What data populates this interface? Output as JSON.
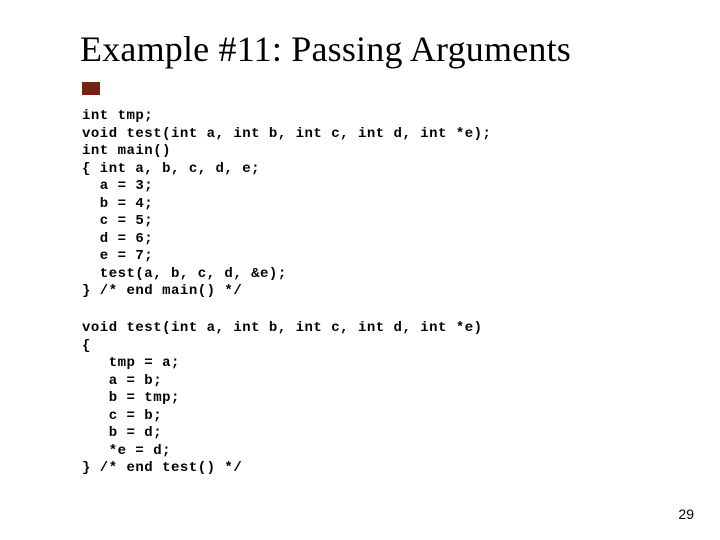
{
  "slide": {
    "title": "Example #11: Passing Arguments",
    "code_block_1": "int tmp;\nvoid test(int a, int b, int c, int d, int *e);\nint main()\n{ int a, b, c, d, e;\n  a = 3;\n  b = 4;\n  c = 5;\n  d = 6;\n  e = 7;\n  test(a, b, c, d, &e);\n} /* end main() */",
    "code_block_2": "void test(int a, int b, int c, int d, int *e)\n{\n   tmp = a;\n   a = b;\n   b = tmp;\n   c = b;\n   b = d;\n   *e = d;\n} /* end test() */",
    "page_number": "29"
  }
}
